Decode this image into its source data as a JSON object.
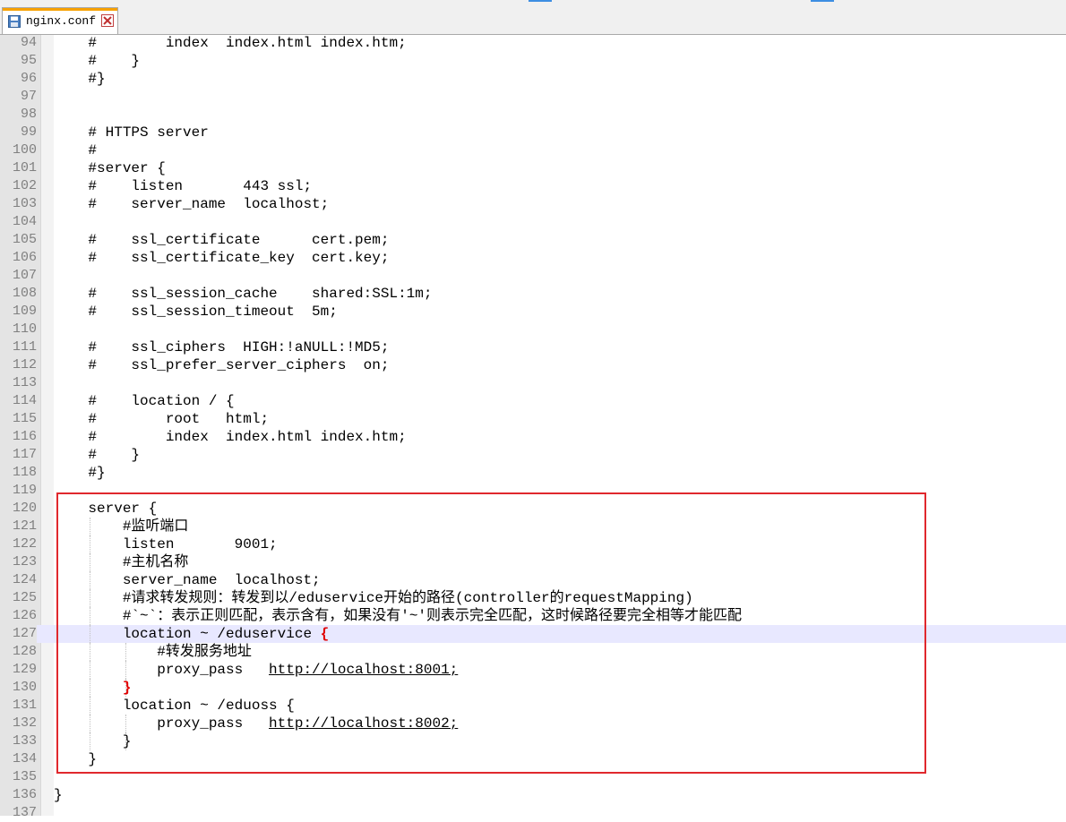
{
  "tab": {
    "title": "nginx.conf",
    "icon": "save-file-icon",
    "close_icon": "close-icon"
  },
  "colors": {
    "highlight_box": "#e0282d",
    "active_brace": "#e00000",
    "current_line": "#e8e8ff",
    "tab_accent": "#f7a100"
  },
  "editor": {
    "current_line": 127,
    "lines": [
      {
        "n": "94",
        "text": "    #        index  index.html index.htm;"
      },
      {
        "n": "95",
        "text": "    #    }"
      },
      {
        "n": "96",
        "text": "    #}"
      },
      {
        "n": "97",
        "text": ""
      },
      {
        "n": "98",
        "text": ""
      },
      {
        "n": "99",
        "text": "    # HTTPS server"
      },
      {
        "n": "100",
        "text": "    #"
      },
      {
        "n": "101",
        "text": "    #server {"
      },
      {
        "n": "102",
        "text": "    #    listen       443 ssl;"
      },
      {
        "n": "103",
        "text": "    #    server_name  localhost;"
      },
      {
        "n": "104",
        "text": ""
      },
      {
        "n": "105",
        "text": "    #    ssl_certificate      cert.pem;"
      },
      {
        "n": "106",
        "text": "    #    ssl_certificate_key  cert.key;"
      },
      {
        "n": "107",
        "text": ""
      },
      {
        "n": "108",
        "text": "    #    ssl_session_cache    shared:SSL:1m;"
      },
      {
        "n": "109",
        "text": "    #    ssl_session_timeout  5m;"
      },
      {
        "n": "110",
        "text": ""
      },
      {
        "n": "111",
        "text": "    #    ssl_ciphers  HIGH:!aNULL:!MD5;"
      },
      {
        "n": "112",
        "text": "    #    ssl_prefer_server_ciphers  on;"
      },
      {
        "n": "113",
        "text": ""
      },
      {
        "n": "114",
        "text": "    #    location / {"
      },
      {
        "n": "115",
        "text": "    #        root   html;"
      },
      {
        "n": "116",
        "text": "    #        index  index.html index.htm;"
      },
      {
        "n": "117",
        "text": "    #    }"
      },
      {
        "n": "118",
        "text": "    #}"
      },
      {
        "n": "119",
        "text": ""
      },
      {
        "n": "120",
        "text": "    server {"
      },
      {
        "n": "121",
        "text": "        #监听端口"
      },
      {
        "n": "122",
        "text": "        listen       9001;"
      },
      {
        "n": "123",
        "text": "        #主机名称"
      },
      {
        "n": "124",
        "text": "        server_name  localhost;"
      },
      {
        "n": "125",
        "text": "        #请求转发规则：转发到以/eduservice开始的路径(controller的requestMapping)"
      },
      {
        "n": "126",
        "text": "        #`~`：表示正则匹配，表示含有，如果没有'~'则表示完全匹配，这时候路径要完全相等才能匹配"
      },
      {
        "n": "127",
        "pre": "        location ~ /eduservice ",
        "brace": "{"
      },
      {
        "n": "128",
        "text": "            #转发服务地址"
      },
      {
        "n": "129",
        "pre": "            proxy_pass   ",
        "url": "http://localhost:8001;"
      },
      {
        "n": "130",
        "pre": "        ",
        "brace": "}"
      },
      {
        "n": "131",
        "text": "        location ~ /eduoss {"
      },
      {
        "n": "132",
        "pre": "            proxy_pass   ",
        "url": "http://localhost:8002;"
      },
      {
        "n": "133",
        "text": "        }"
      },
      {
        "n": "134",
        "text": "    }"
      },
      {
        "n": "135",
        "text": ""
      },
      {
        "n": "136",
        "text": "}"
      },
      {
        "n": "137",
        "text": ""
      }
    ]
  }
}
